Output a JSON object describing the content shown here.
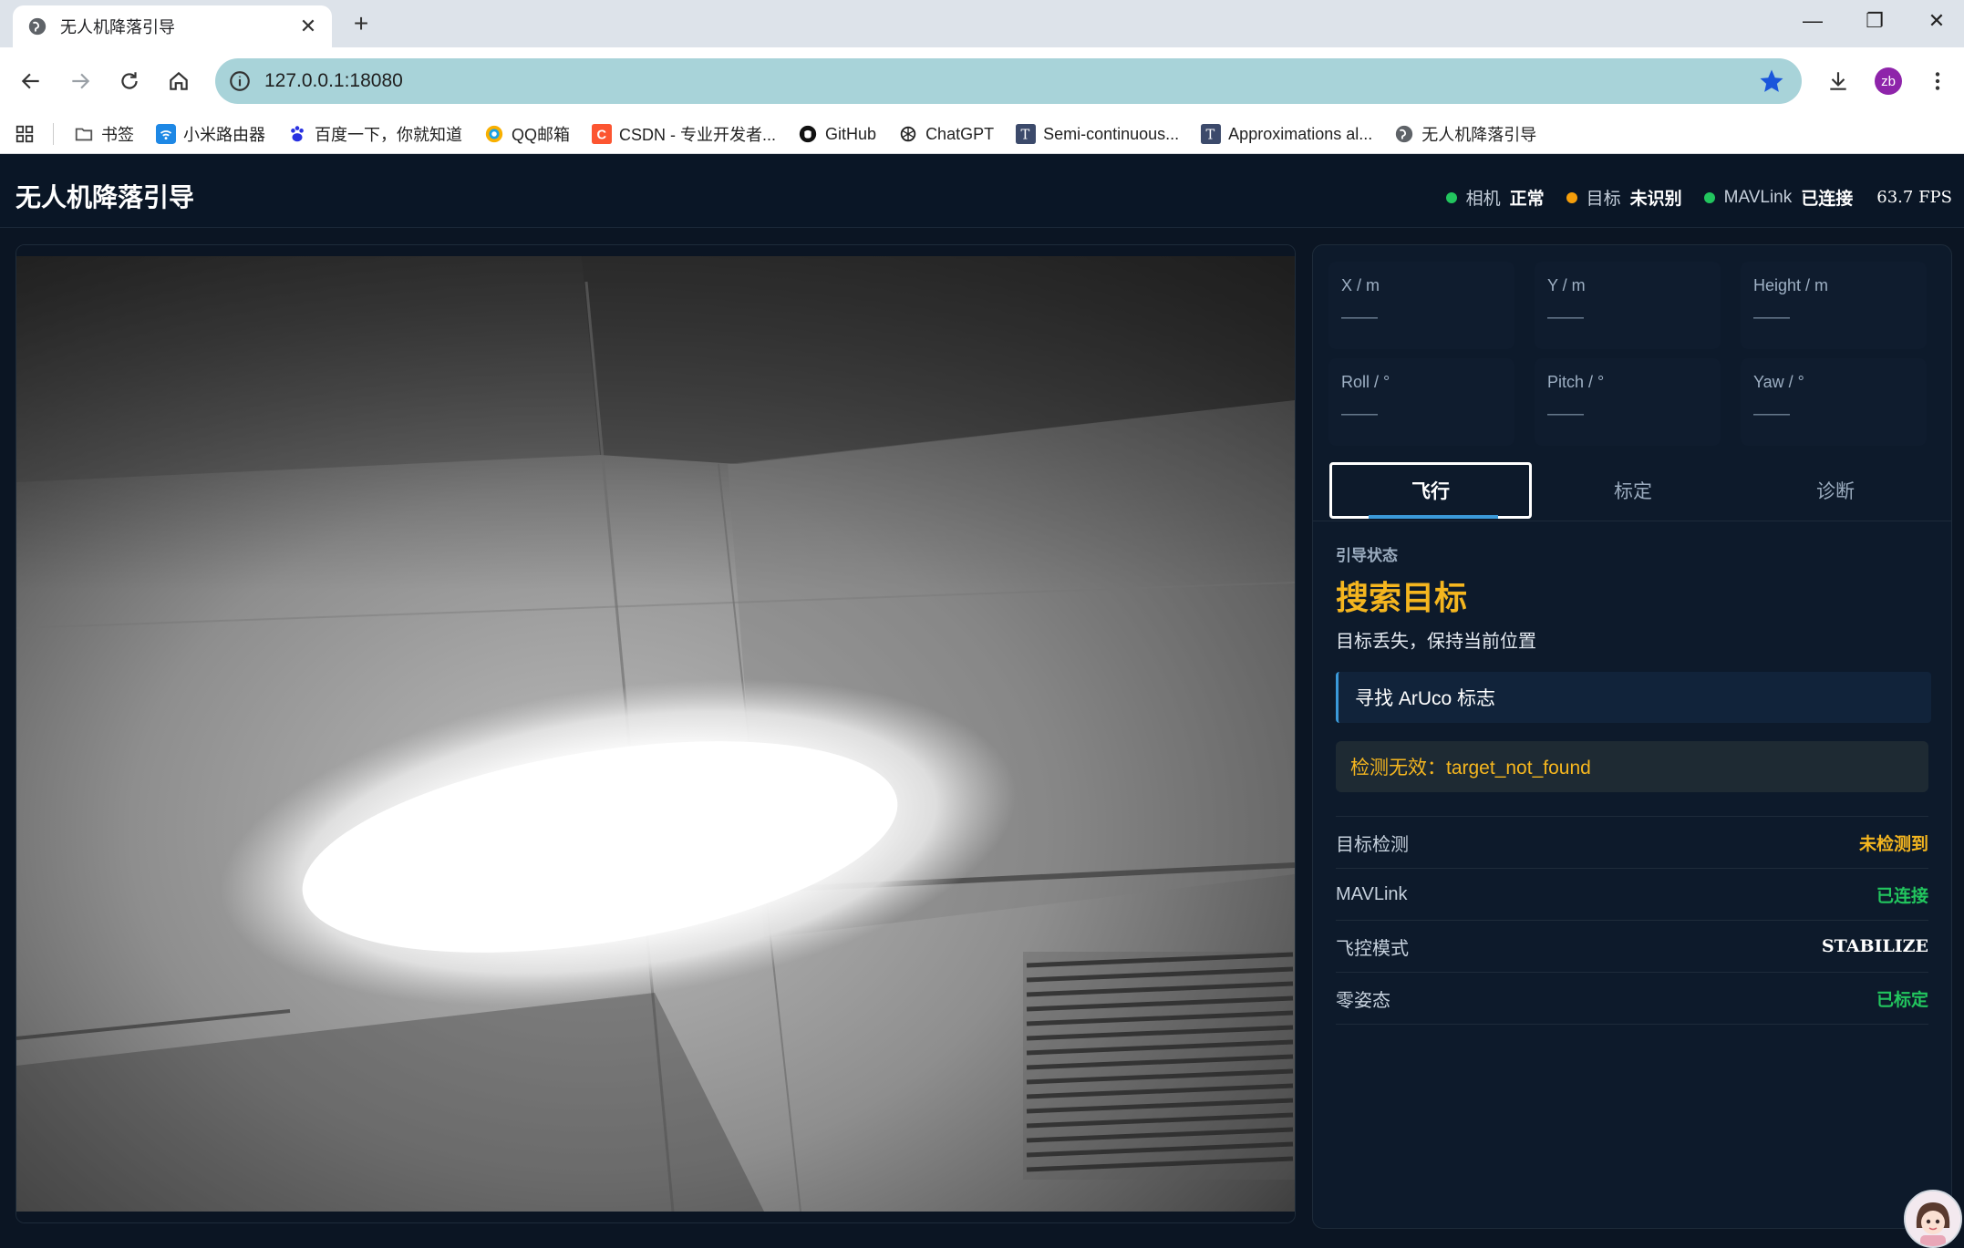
{
  "browser": {
    "tab_title": "无人机降落引导",
    "new_tab": "+",
    "url": "127.0.0.1:18080",
    "profile_initials": "zb",
    "bookmarks": [
      {
        "label": "书签",
        "icon": "folder-icon"
      },
      {
        "label": "小米路由器",
        "icon": "wifi-icon"
      },
      {
        "label": "百度一下，你就知道",
        "icon": "baidu-paw-icon"
      },
      {
        "label": "QQ邮箱",
        "icon": "qq-mail-icon"
      },
      {
        "label": "CSDN - 专业开发者...",
        "icon": "csdn-icon"
      },
      {
        "label": "GitHub",
        "icon": "github-icon"
      },
      {
        "label": "ChatGPT",
        "icon": "chatgpt-icon"
      },
      {
        "label": "Semi-continuous...",
        "icon": "t-icon"
      },
      {
        "label": "Approximations al...",
        "icon": "t-icon"
      },
      {
        "label": "无人机降落引导",
        "icon": "globe-icon"
      }
    ]
  },
  "app": {
    "title": "无人机降落引导",
    "status": [
      {
        "label": "相机",
        "value": "正常",
        "color": "#22c55e"
      },
      {
        "label": "目标",
        "value": "未识别",
        "color": "#f59e0b"
      },
      {
        "label": "MAVLink",
        "value": "已连接",
        "color": "#22c55e"
      }
    ],
    "fps": "63.7 FPS"
  },
  "metrics": [
    {
      "label": "X / m",
      "value": "——"
    },
    {
      "label": "Y / m",
      "value": "——"
    },
    {
      "label": "Height / m",
      "value": "——"
    },
    {
      "label": "Roll / °",
      "value": "——"
    },
    {
      "label": "Pitch / °",
      "value": "——"
    },
    {
      "label": "Yaw / °",
      "value": "——"
    }
  ],
  "tabs": [
    {
      "label": "飞行",
      "active": true
    },
    {
      "label": "标定",
      "active": false
    },
    {
      "label": "诊断",
      "active": false
    }
  ],
  "guidance": {
    "section_label": "引导状态",
    "state": "搜索目标",
    "description": "目标丢失，保持当前位置",
    "hint": "寻找 ArUco 标志",
    "warning": "检测无效：target_not_found"
  },
  "kv": [
    {
      "key": "目标检测",
      "value": "未检测到",
      "color": "#f5b61f"
    },
    {
      "key": "MAVLink",
      "value": "已连接",
      "color": "#22c55e"
    },
    {
      "key": "飞控模式",
      "value": "STABILIZE",
      "color": "#ffffff"
    },
    {
      "key": "零姿态",
      "value": "已标定",
      "color": "#22c55e"
    }
  ]
}
